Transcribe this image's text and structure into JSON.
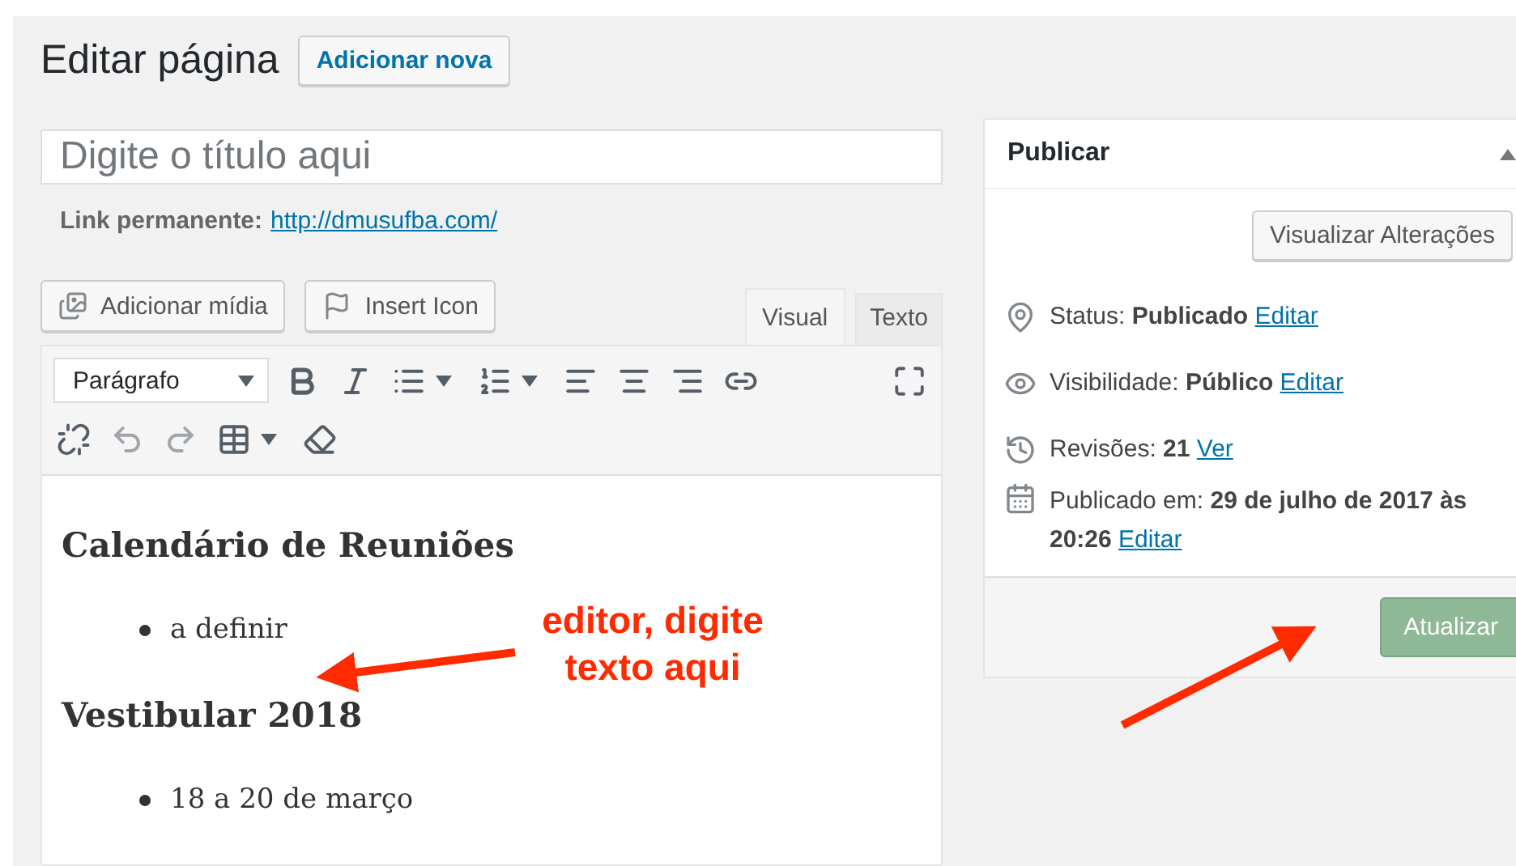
{
  "page": {
    "title": "Editar página",
    "add_new_button": "Adicionar nova"
  },
  "title_field": {
    "placeholder": "Digite o título aqui"
  },
  "permalink": {
    "label": "Link permanente:",
    "url": "http://dmusufba.com/"
  },
  "media_buttons": [
    {
      "kind": "media",
      "label": "Adicionar mídia"
    },
    {
      "kind": "flag",
      "label": "Insert Icon"
    }
  ],
  "editor_tabs": [
    {
      "label": "Visual",
      "selected": true
    },
    {
      "label": "Texto",
      "selected": false
    }
  ],
  "format_select": {
    "value": "Parágrafo"
  },
  "toolbar": [
    [
      {
        "kind": "bold",
        "disabled": false
      },
      {
        "kind": "italic",
        "disabled": false
      },
      {
        "kind": "bullet-list",
        "disabled": false
      },
      {
        "kind": "numbered-list",
        "disabled": false
      },
      {
        "kind": "align-left",
        "disabled": false
      },
      {
        "kind": "align-center",
        "disabled": false
      },
      {
        "kind": "align-right",
        "disabled": false
      },
      {
        "kind": "link",
        "disabled": false
      },
      {
        "kind": "fullscreen",
        "disabled": false
      }
    ],
    [
      {
        "kind": "unlink",
        "disabled": false
      },
      {
        "kind": "undo",
        "disabled": true
      },
      {
        "kind": "redo",
        "disabled": true
      },
      {
        "kind": "table",
        "disabled": false
      },
      {
        "kind": "clear",
        "disabled": false
      }
    ]
  ],
  "content": [
    {
      "kind": "heading",
      "text": "Calendário de Reuniões"
    },
    {
      "kind": "bullet",
      "text": "a definir"
    },
    {
      "kind": "heading",
      "text": "Vestibular 2018"
    },
    {
      "kind": "bullet",
      "text": "18 a 20 de março"
    }
  ],
  "annotation": {
    "text": "editor, digite texto aqui"
  },
  "publish_box": {
    "title": "Publicar",
    "expanded": true,
    "preview_button": "Visualizar Alterações",
    "items": [
      {
        "kind": "status",
        "text": "Status: **Publicado**",
        "link": "Editar"
      },
      {
        "kind": "visibility",
        "text": "Visibilidade: **Público**",
        "link": "Editar"
      },
      {
        "kind": "revisions",
        "text": "Revisões: **21**",
        "link": "Ver"
      },
      {
        "kind": "date",
        "text": "Publicado em: **29 de julho de 2017 às 20:26**",
        "link": "Editar"
      }
    ],
    "update_button": "Atualizar"
  }
}
